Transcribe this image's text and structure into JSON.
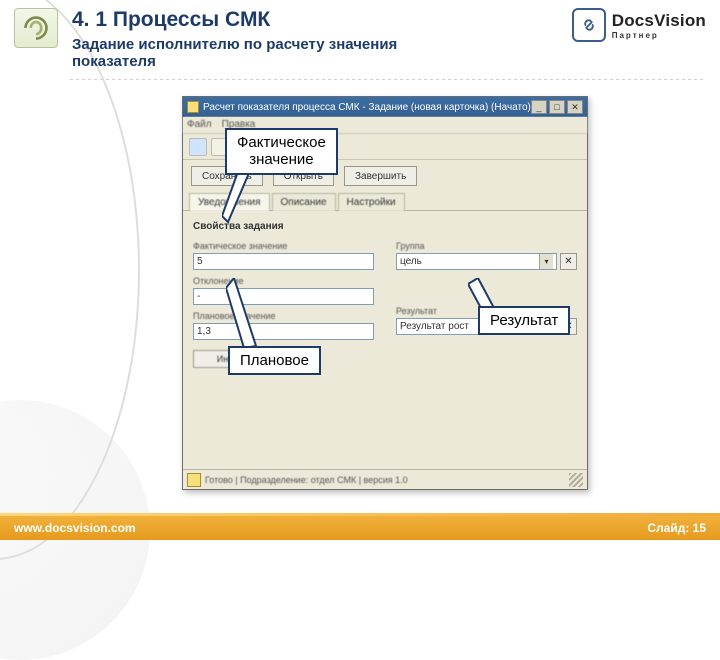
{
  "header": {
    "title": "4. 1 Процессы СМК",
    "subtitle": "Задание исполнителю по расчету значения показателя"
  },
  "brand": {
    "name": "DocsVision",
    "tagline": "Партнер"
  },
  "window": {
    "title": "Расчет показателя процесса СМК - Задание (новая карточка) (Начато)",
    "menu": {
      "m1": "Файл",
      "m2": "Правка"
    },
    "buttons": {
      "save": "Сохранить",
      "open": "Открыть",
      "close": "Завершить"
    },
    "tabs": {
      "t1": "Уведомления",
      "t2": "Описание",
      "t3": "Настройки"
    },
    "section": "Свойства задания",
    "left": {
      "l1": "Фактическое значение",
      "v1": "5",
      "l2": "Отклонение",
      "v2": "-",
      "l3": "Плановое значение",
      "v3": "1,3",
      "btn": "Инструкция"
    },
    "right": {
      "l1": "Группа",
      "v1": "цель",
      "l2": "Результат",
      "v2": "Результат рост"
    },
    "status": "Готово | Подразделение: отдел СМК | версия 1.0"
  },
  "callouts": {
    "factual": "Фактическое\nзначение",
    "plan": "Плановое",
    "result": "Результат"
  },
  "footer": {
    "url": "www.docsvision.com",
    "slide": "Слайд: 15"
  }
}
